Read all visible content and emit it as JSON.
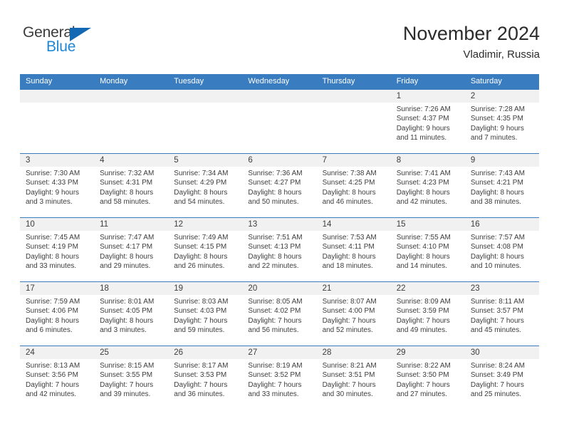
{
  "brand": {
    "name_primary": "General",
    "name_secondary": "Blue",
    "primary_color": "#3b3b3b",
    "secondary_color": "#1e87d6",
    "triangle_color": "#1268b3"
  },
  "header": {
    "title": "November 2024",
    "subtitle": "Vladimir, Russia"
  },
  "theme": {
    "header_bg": "#3a7cc0",
    "header_text": "#ffffff",
    "date_band_bg": "#f1f1f1",
    "cell_bg": "#ffffff",
    "text_color": "#3d3d3d",
    "row_border": "#3a7cc0"
  },
  "weekdays": [
    "Sunday",
    "Monday",
    "Tuesday",
    "Wednesday",
    "Thursday",
    "Friday",
    "Saturday"
  ],
  "weeks": [
    [
      {
        "day": "",
        "lines": [
          "",
          "",
          "",
          ""
        ]
      },
      {
        "day": "",
        "lines": [
          "",
          "",
          "",
          ""
        ]
      },
      {
        "day": "",
        "lines": [
          "",
          "",
          "",
          ""
        ]
      },
      {
        "day": "",
        "lines": [
          "",
          "",
          "",
          ""
        ]
      },
      {
        "day": "",
        "lines": [
          "",
          "",
          "",
          ""
        ]
      },
      {
        "day": "1",
        "lines": [
          "Sunrise: 7:26 AM",
          "Sunset: 4:37 PM",
          "Daylight: 9 hours",
          "and 11 minutes."
        ]
      },
      {
        "day": "2",
        "lines": [
          "Sunrise: 7:28 AM",
          "Sunset: 4:35 PM",
          "Daylight: 9 hours",
          "and 7 minutes."
        ]
      }
    ],
    [
      {
        "day": "3",
        "lines": [
          "Sunrise: 7:30 AM",
          "Sunset: 4:33 PM",
          "Daylight: 9 hours",
          "and 3 minutes."
        ]
      },
      {
        "day": "4",
        "lines": [
          "Sunrise: 7:32 AM",
          "Sunset: 4:31 PM",
          "Daylight: 8 hours",
          "and 58 minutes."
        ]
      },
      {
        "day": "5",
        "lines": [
          "Sunrise: 7:34 AM",
          "Sunset: 4:29 PM",
          "Daylight: 8 hours",
          "and 54 minutes."
        ]
      },
      {
        "day": "6",
        "lines": [
          "Sunrise: 7:36 AM",
          "Sunset: 4:27 PM",
          "Daylight: 8 hours",
          "and 50 minutes."
        ]
      },
      {
        "day": "7",
        "lines": [
          "Sunrise: 7:38 AM",
          "Sunset: 4:25 PM",
          "Daylight: 8 hours",
          "and 46 minutes."
        ]
      },
      {
        "day": "8",
        "lines": [
          "Sunrise: 7:41 AM",
          "Sunset: 4:23 PM",
          "Daylight: 8 hours",
          "and 42 minutes."
        ]
      },
      {
        "day": "9",
        "lines": [
          "Sunrise: 7:43 AM",
          "Sunset: 4:21 PM",
          "Daylight: 8 hours",
          "and 38 minutes."
        ]
      }
    ],
    [
      {
        "day": "10",
        "lines": [
          "Sunrise: 7:45 AM",
          "Sunset: 4:19 PM",
          "Daylight: 8 hours",
          "and 33 minutes."
        ]
      },
      {
        "day": "11",
        "lines": [
          "Sunrise: 7:47 AM",
          "Sunset: 4:17 PM",
          "Daylight: 8 hours",
          "and 29 minutes."
        ]
      },
      {
        "day": "12",
        "lines": [
          "Sunrise: 7:49 AM",
          "Sunset: 4:15 PM",
          "Daylight: 8 hours",
          "and 26 minutes."
        ]
      },
      {
        "day": "13",
        "lines": [
          "Sunrise: 7:51 AM",
          "Sunset: 4:13 PM",
          "Daylight: 8 hours",
          "and 22 minutes."
        ]
      },
      {
        "day": "14",
        "lines": [
          "Sunrise: 7:53 AM",
          "Sunset: 4:11 PM",
          "Daylight: 8 hours",
          "and 18 minutes."
        ]
      },
      {
        "day": "15",
        "lines": [
          "Sunrise: 7:55 AM",
          "Sunset: 4:10 PM",
          "Daylight: 8 hours",
          "and 14 minutes."
        ]
      },
      {
        "day": "16",
        "lines": [
          "Sunrise: 7:57 AM",
          "Sunset: 4:08 PM",
          "Daylight: 8 hours",
          "and 10 minutes."
        ]
      }
    ],
    [
      {
        "day": "17",
        "lines": [
          "Sunrise: 7:59 AM",
          "Sunset: 4:06 PM",
          "Daylight: 8 hours",
          "and 6 minutes."
        ]
      },
      {
        "day": "18",
        "lines": [
          "Sunrise: 8:01 AM",
          "Sunset: 4:05 PM",
          "Daylight: 8 hours",
          "and 3 minutes."
        ]
      },
      {
        "day": "19",
        "lines": [
          "Sunrise: 8:03 AM",
          "Sunset: 4:03 PM",
          "Daylight: 7 hours",
          "and 59 minutes."
        ]
      },
      {
        "day": "20",
        "lines": [
          "Sunrise: 8:05 AM",
          "Sunset: 4:02 PM",
          "Daylight: 7 hours",
          "and 56 minutes."
        ]
      },
      {
        "day": "21",
        "lines": [
          "Sunrise: 8:07 AM",
          "Sunset: 4:00 PM",
          "Daylight: 7 hours",
          "and 52 minutes."
        ]
      },
      {
        "day": "22",
        "lines": [
          "Sunrise: 8:09 AM",
          "Sunset: 3:59 PM",
          "Daylight: 7 hours",
          "and 49 minutes."
        ]
      },
      {
        "day": "23",
        "lines": [
          "Sunrise: 8:11 AM",
          "Sunset: 3:57 PM",
          "Daylight: 7 hours",
          "and 45 minutes."
        ]
      }
    ],
    [
      {
        "day": "24",
        "lines": [
          "Sunrise: 8:13 AM",
          "Sunset: 3:56 PM",
          "Daylight: 7 hours",
          "and 42 minutes."
        ]
      },
      {
        "day": "25",
        "lines": [
          "Sunrise: 8:15 AM",
          "Sunset: 3:55 PM",
          "Daylight: 7 hours",
          "and 39 minutes."
        ]
      },
      {
        "day": "26",
        "lines": [
          "Sunrise: 8:17 AM",
          "Sunset: 3:53 PM",
          "Daylight: 7 hours",
          "and 36 minutes."
        ]
      },
      {
        "day": "27",
        "lines": [
          "Sunrise: 8:19 AM",
          "Sunset: 3:52 PM",
          "Daylight: 7 hours",
          "and 33 minutes."
        ]
      },
      {
        "day": "28",
        "lines": [
          "Sunrise: 8:21 AM",
          "Sunset: 3:51 PM",
          "Daylight: 7 hours",
          "and 30 minutes."
        ]
      },
      {
        "day": "29",
        "lines": [
          "Sunrise: 8:22 AM",
          "Sunset: 3:50 PM",
          "Daylight: 7 hours",
          "and 27 minutes."
        ]
      },
      {
        "day": "30",
        "lines": [
          "Sunrise: 8:24 AM",
          "Sunset: 3:49 PM",
          "Daylight: 7 hours",
          "and 25 minutes."
        ]
      }
    ]
  ]
}
